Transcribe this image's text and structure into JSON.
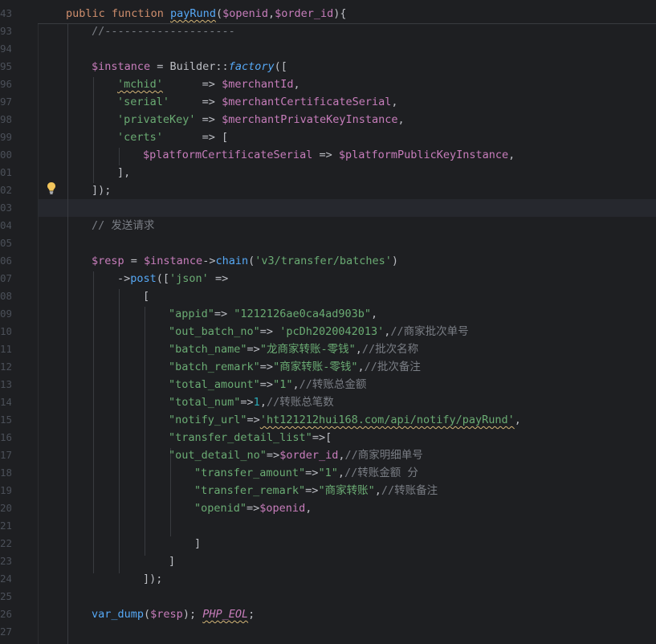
{
  "lines": [
    {
      "num": "43",
      "segments": [
        [
          "kw",
          "public function "
        ],
        [
          "fn",
          "payRund"
        ],
        [
          "plain",
          "("
        ],
        [
          "var",
          "$openid"
        ],
        [
          "plain",
          ","
        ],
        [
          "var",
          "$order_id"
        ],
        [
          "plain",
          "){"
        ]
      ]
    },
    {
      "num": "93",
      "segments": [
        [
          "cmt",
          "//--------------------"
        ]
      ]
    },
    {
      "num": "94",
      "segments": []
    },
    {
      "num": "95",
      "segments": [
        [
          "var",
          "$instance"
        ],
        [
          "plain",
          " = Builder::"
        ],
        [
          "stat",
          "factory"
        ],
        [
          "plain",
          "(["
        ]
      ]
    },
    {
      "num": "96",
      "segments": [
        [
          "str",
          "'mchid'"
        ],
        [
          "plain",
          "      => "
        ],
        [
          "var",
          "$merchantId"
        ],
        [
          "plain",
          ","
        ]
      ]
    },
    {
      "num": "97",
      "segments": [
        [
          "str",
          "'serial'"
        ],
        [
          "plain",
          "     => "
        ],
        [
          "var",
          "$merchantCertificateSerial"
        ],
        [
          "plain",
          ","
        ]
      ]
    },
    {
      "num": "98",
      "segments": [
        [
          "str",
          "'privateKey'"
        ],
        [
          "plain",
          " => "
        ],
        [
          "var",
          "$merchantPrivateKeyInstance"
        ],
        [
          "plain",
          ","
        ]
      ]
    },
    {
      "num": "99",
      "segments": [
        [
          "str",
          "'certs'"
        ],
        [
          "plain",
          "      => ["
        ]
      ]
    },
    {
      "num": "00",
      "segments": [
        [
          "var",
          "$platformCertificateSerial"
        ],
        [
          "plain",
          " => "
        ],
        [
          "var",
          "$platformPublicKeyInstance"
        ],
        [
          "plain",
          ","
        ]
      ]
    },
    {
      "num": "01",
      "segments": [
        [
          "plain",
          "],"
        ]
      ]
    },
    {
      "num": "02",
      "segments": [
        [
          "plain",
          "]);"
        ]
      ]
    },
    {
      "num": "03",
      "segments": []
    },
    {
      "num": "04",
      "segments": [
        [
          "cmt",
          "// 发送请求"
        ]
      ]
    },
    {
      "num": "05",
      "segments": []
    },
    {
      "num": "06",
      "segments": [
        [
          "var",
          "$resp"
        ],
        [
          "plain",
          " = "
        ],
        [
          "var",
          "$instance"
        ],
        [
          "plain",
          "->"
        ],
        [
          "fn",
          "chain"
        ],
        [
          "plain",
          "("
        ],
        [
          "str",
          "'v3/transfer/batches'"
        ],
        [
          "plain",
          ")"
        ]
      ]
    },
    {
      "num": "07",
      "segments": [
        [
          "plain",
          "->"
        ],
        [
          "fn",
          "post"
        ],
        [
          "plain",
          "(["
        ],
        [
          "str",
          "'json'"
        ],
        [
          "plain",
          " =>"
        ]
      ]
    },
    {
      "num": "08",
      "segments": [
        [
          "plain",
          "["
        ]
      ]
    },
    {
      "num": "09",
      "segments": [
        [
          "str",
          "\"appid\""
        ],
        [
          "plain",
          "=> "
        ],
        [
          "str",
          "\"1212126ae0ca4ad903b\""
        ],
        [
          "plain",
          ","
        ]
      ]
    },
    {
      "num": "10",
      "segments": [
        [
          "str",
          "\"out_batch_no\""
        ],
        [
          "plain",
          "=> "
        ],
        [
          "str",
          "'pcDh2020042013'"
        ],
        [
          "plain",
          ","
        ],
        [
          "cmt",
          "//商家批次单号"
        ]
      ]
    },
    {
      "num": "11",
      "segments": [
        [
          "str",
          "\"batch_name\""
        ],
        [
          "plain",
          "=>"
        ],
        [
          "str",
          "\"龙商家转账-零钱\""
        ],
        [
          "plain",
          ","
        ],
        [
          "cmt",
          "//批次名称"
        ]
      ]
    },
    {
      "num": "12",
      "segments": [
        [
          "str",
          "\"batch_remark\""
        ],
        [
          "plain",
          "=>"
        ],
        [
          "str",
          "\"商家转账-零钱\""
        ],
        [
          "plain",
          ","
        ],
        [
          "cmt",
          "//批次备注"
        ]
      ]
    },
    {
      "num": "13",
      "segments": [
        [
          "str",
          "\"total_amount\""
        ],
        [
          "plain",
          "=>"
        ],
        [
          "str",
          "\"1\""
        ],
        [
          "plain",
          ","
        ],
        [
          "cmt",
          "//转账总金额"
        ]
      ]
    },
    {
      "num": "14",
      "segments": [
        [
          "str",
          "\"total_num\""
        ],
        [
          "plain",
          "=>"
        ],
        [
          "num",
          "1"
        ],
        [
          "plain",
          ","
        ],
        [
          "cmt",
          "//转账总笔数"
        ]
      ]
    },
    {
      "num": "15",
      "segments": [
        [
          "str",
          "\"notify_url\""
        ],
        [
          "plain",
          "=>"
        ],
        [
          "str",
          "'ht121212hui168.com/api/notify/payRund'"
        ],
        [
          "plain",
          ","
        ]
      ]
    },
    {
      "num": "16",
      "segments": [
        [
          "str",
          "\"transfer_detail_list\""
        ],
        [
          "plain",
          "=>["
        ]
      ]
    },
    {
      "num": "17",
      "segments": [
        [
          "str",
          "\"out_detail_no\""
        ],
        [
          "plain",
          "=>"
        ],
        [
          "var",
          "$order_id"
        ],
        [
          "plain",
          ","
        ],
        [
          "cmt",
          "//商家明细单号"
        ]
      ]
    },
    {
      "num": "18",
      "segments": [
        [
          "str",
          "\"transfer_amount\""
        ],
        [
          "plain",
          "=>"
        ],
        [
          "str",
          "\"1\""
        ],
        [
          "plain",
          ","
        ],
        [
          "cmt",
          "//转账金额 分"
        ]
      ]
    },
    {
      "num": "19",
      "segments": [
        [
          "str",
          "\"transfer_remark\""
        ],
        [
          "plain",
          "=>"
        ],
        [
          "str",
          "\"商家转账\""
        ],
        [
          "plain",
          ","
        ],
        [
          "cmt",
          "//转账备注"
        ]
      ]
    },
    {
      "num": "20",
      "segments": [
        [
          "str",
          "\"openid\""
        ],
        [
          "plain",
          "=>"
        ],
        [
          "var",
          "$openid"
        ],
        [
          "plain",
          ","
        ]
      ]
    },
    {
      "num": "21",
      "segments": []
    },
    {
      "num": "22",
      "segments": [
        [
          "plain",
          "]"
        ]
      ]
    },
    {
      "num": "23",
      "segments": [
        [
          "plain",
          "]"
        ]
      ]
    },
    {
      "num": "24",
      "segments": [
        [
          "plain",
          "]);"
        ]
      ]
    },
    {
      "num": "25",
      "segments": []
    },
    {
      "num": "26",
      "segments": [
        [
          "fn",
          "var_dump"
        ],
        [
          "plain",
          "("
        ],
        [
          "var",
          "$resp"
        ],
        [
          "plain",
          "); "
        ],
        [
          "const",
          "PHP_EOL"
        ],
        [
          "plain",
          ";"
        ]
      ]
    },
    {
      "num": "27",
      "segments": []
    }
  ],
  "colors": {
    "background": "#1e1f22",
    "current_line": "#26282e",
    "keyword": "#cf8e6d",
    "function": "#56a8f5",
    "variable": "#c77dbb",
    "string": "#6aab73",
    "comment": "#7a7e85"
  },
  "icons": {
    "intention": "lightbulb-icon"
  }
}
